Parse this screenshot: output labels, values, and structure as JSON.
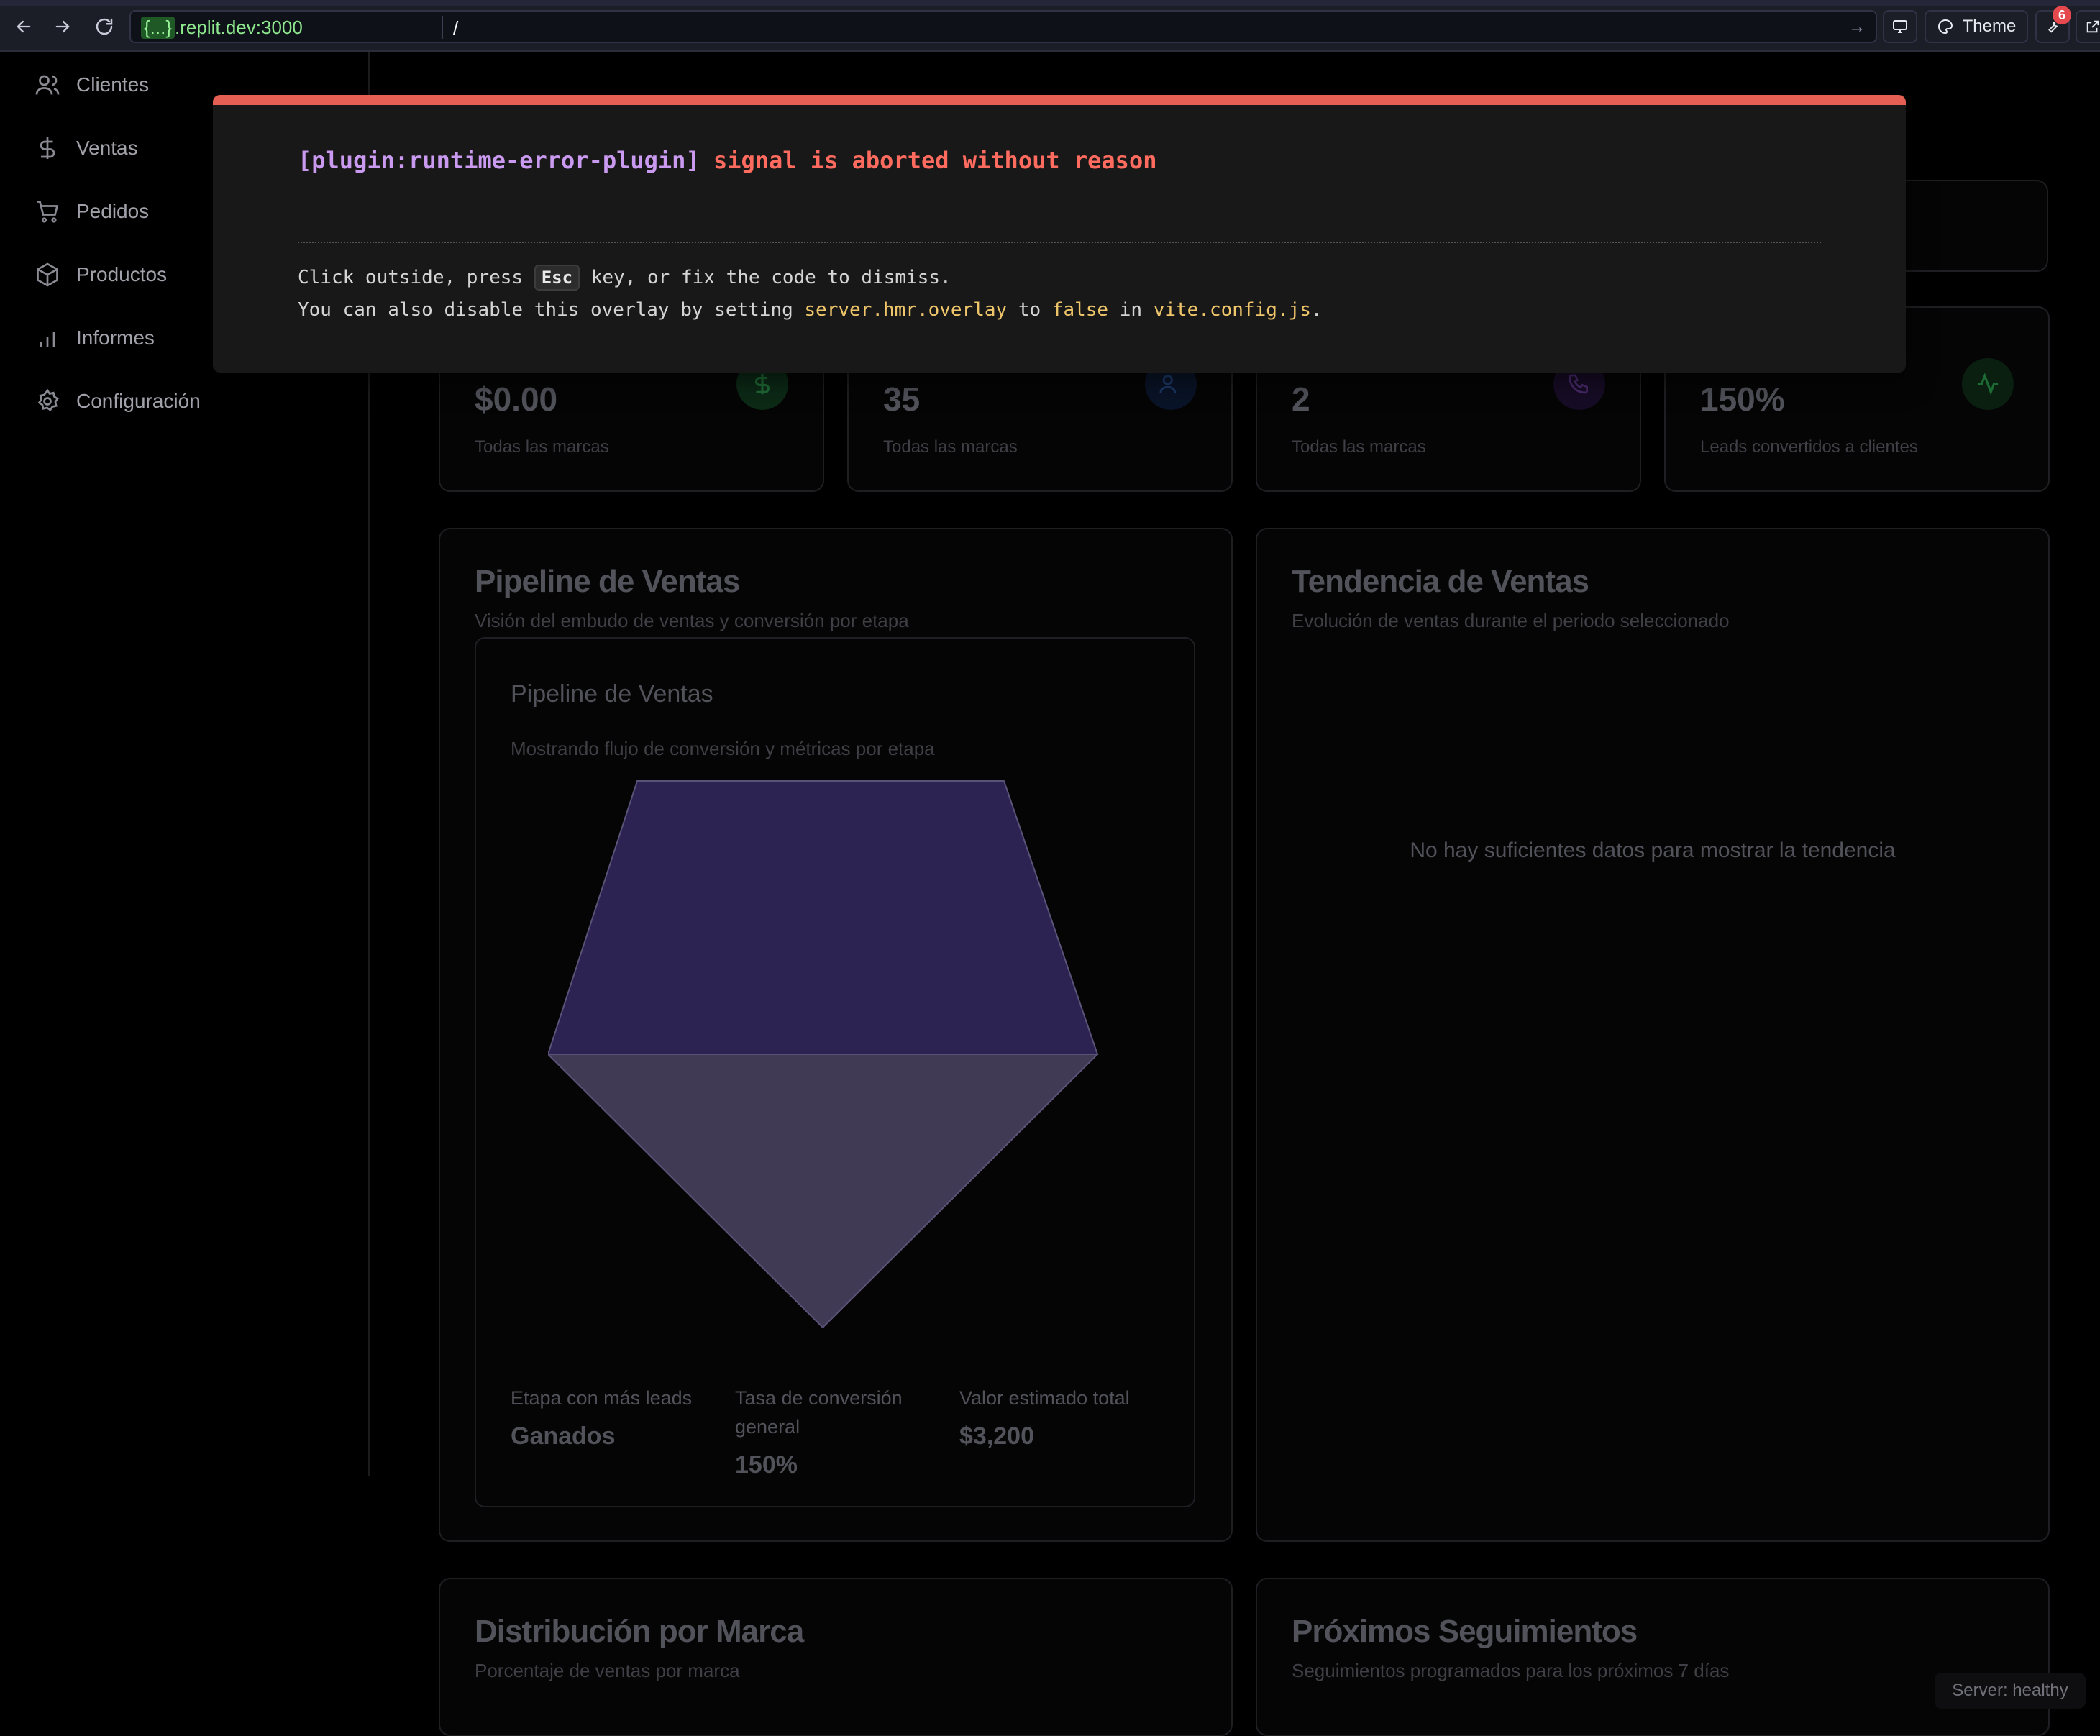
{
  "browser": {
    "url_origin_brace": "{...}",
    "url_origin_rest": ".replit.dev:3000",
    "url_path": "/",
    "theme_label": "Theme",
    "notification_count": "6"
  },
  "sidebar": {
    "items": [
      {
        "label": "Clientes",
        "icon": "users-icon"
      },
      {
        "label": "Ventas",
        "icon": "dollar-icon"
      },
      {
        "label": "Pedidos",
        "icon": "cart-icon"
      },
      {
        "label": "Productos",
        "icon": "box-icon"
      },
      {
        "label": "Informes",
        "icon": "bar-chart-icon"
      },
      {
        "label": "Configuración",
        "icon": "gear-icon"
      }
    ]
  },
  "stats": [
    {
      "value": "$0.00",
      "sub": "Todas las marcas",
      "icon": "dollar-icon",
      "color": "#16a34a"
    },
    {
      "value": "35",
      "sub": "Todas las marcas",
      "icon": "users-icon",
      "color": "#3b82f6"
    },
    {
      "value": "2",
      "sub": "Todas las marcas",
      "icon": "phone-icon",
      "color": "#a855f7"
    },
    {
      "value": "150%",
      "sub": "Leads convertidos a clientes",
      "icon": "activity-icon",
      "color": "#22c55e"
    }
  ],
  "pipeline": {
    "title": "Pipeline de Ventas",
    "description": "Visión del embudo de ventas y conversión por etapa",
    "inner_title": "Pipeline de Ventas",
    "inner_description": "Mostrando flujo de conversión y métricas por etapa",
    "metrics": [
      {
        "label": "Etapa con más leads",
        "value": "Ganados"
      },
      {
        "label": "Tasa de conversión general",
        "value": "150%"
      },
      {
        "label": "Valor estimado total",
        "value": "$3,200"
      }
    ],
    "colors": {
      "top_stage": "#2d2352",
      "bottom_stage": "#403a55"
    }
  },
  "trend": {
    "title": "Tendencia de Ventas",
    "description": "Evolución de ventas durante el periodo seleccionado",
    "empty_message": "No hay suficientes datos para mostrar la tendencia"
  },
  "brand_distribution": {
    "title": "Distribución por Marca",
    "description": "Porcentaje de ventas por marca"
  },
  "followups": {
    "title": "Próximos Seguimientos",
    "description": "Seguimientos programados para los próximos 7 días"
  },
  "status": {
    "label": "Server: healthy"
  },
  "error_overlay": {
    "plugin": "[plugin:runtime-error-plugin]",
    "message": "signal is aborted without reason",
    "tip1_before": "Click outside, press",
    "tip1_key": "Esc",
    "tip1_after": "key, or fix the code to dismiss.",
    "tip2_before": "You can also disable this overlay by setting",
    "tip2_code1": "server.hmr.overlay",
    "tip2_mid1": "to",
    "tip2_code2": "false",
    "tip2_mid2": "in",
    "tip2_code3": "vite.config.js",
    "tip2_end": "."
  }
}
